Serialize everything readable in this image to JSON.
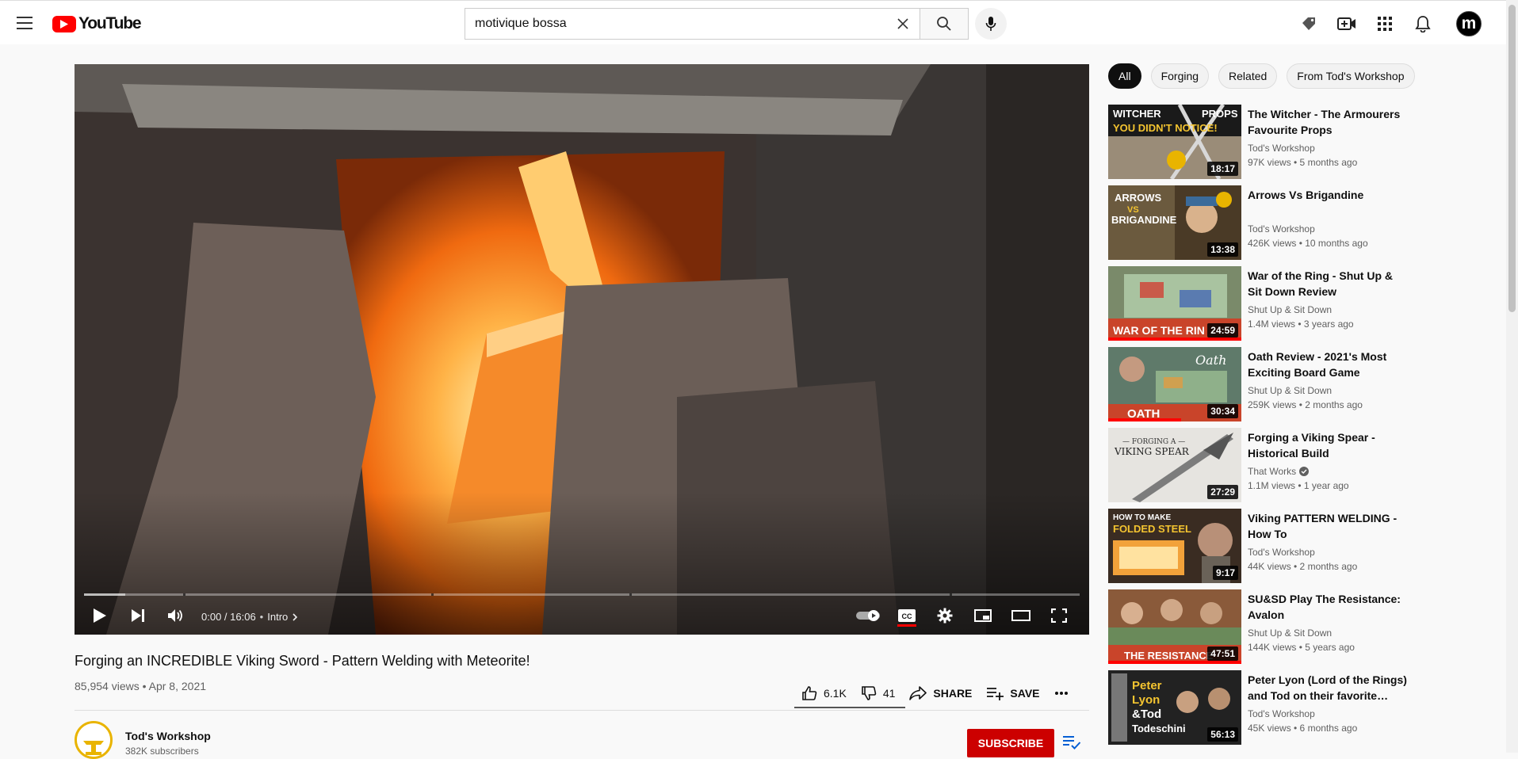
{
  "header": {
    "logo_text": "YouTube",
    "search_value": "motivique bossa",
    "avatar_letter": "m"
  },
  "player": {
    "time": "0:00 / 16:06",
    "chapter": "Intro",
    "progress_fraction": 0.0
  },
  "video": {
    "title": "Forging an INCREDIBLE Viking Sword - Pattern Welding with Meteorite!",
    "meta": "85,954 views • Apr 8, 2021",
    "likes": "6.1K",
    "dislikes": "41",
    "share_label": "SHARE",
    "save_label": "SAVE"
  },
  "channel": {
    "name": "Tod's Workshop",
    "subscribers": "382K subscribers",
    "subscribe_label": "SUBSCRIBE"
  },
  "chips": [
    "All",
    "Forging",
    "Related",
    "From Tod's Workshop"
  ],
  "recommendations": [
    {
      "title": "The Witcher - The Armourers Favourite Props",
      "channel": "Tod's Workshop",
      "stats": "97K views • 5 months ago",
      "duration": "18:17",
      "verified": false,
      "watched": 0,
      "thumb_text": "WITCHER PROPS YOU DIDN'T NOTICE!"
    },
    {
      "title": "Arrows Vs Brigandine",
      "channel": "Tod's Workshop",
      "stats": "426K views • 10 months ago",
      "duration": "13:38",
      "verified": false,
      "watched": 0,
      "thumb_text": "ARROWS VS BRIGANDINE"
    },
    {
      "title": "War of the Ring - Shut Up & Sit Down Review",
      "channel": "Shut Up & Sit Down",
      "stats": "1.4M views • 3 years ago",
      "duration": "24:59",
      "verified": false,
      "watched": 1.0,
      "thumb_text": "WAR OF THE RIN"
    },
    {
      "title": "Oath Review - 2021's Most Exciting Board Game",
      "channel": "Shut Up & Sit Down",
      "stats": "259K views • 2 months ago",
      "duration": "30:34",
      "verified": false,
      "watched": 0.55,
      "thumb_text": "OATH"
    },
    {
      "title": "Forging a Viking Spear - Historical Build",
      "channel": "That Works",
      "stats": "1.1M views • 1 year ago",
      "duration": "27:29",
      "verified": true,
      "watched": 0,
      "thumb_text": "FORGING A VIKING SPEAR"
    },
    {
      "title": "Viking PATTERN WELDING - How To",
      "channel": "Tod's Workshop",
      "stats": "44K views • 2 months ago",
      "duration": "9:17",
      "verified": false,
      "watched": 0,
      "thumb_text": "HOW TO MAKE FOLDED STEEL"
    },
    {
      "title": "SU&SD Play The Resistance: Avalon",
      "channel": "Shut Up & Sit Down",
      "stats": "144K views • 5 years ago",
      "duration": "47:51",
      "verified": false,
      "watched": 1.0,
      "thumb_text": "THE RESISTANCE"
    },
    {
      "title": "Peter Lyon (Lord of the Rings) and Tod on their favorite…",
      "channel": "Tod's Workshop",
      "stats": "45K views • 6 months ago",
      "duration": "56:13",
      "verified": false,
      "watched": 0,
      "thumb_text": "Peter Lyon &Tod Todeschini"
    }
  ]
}
